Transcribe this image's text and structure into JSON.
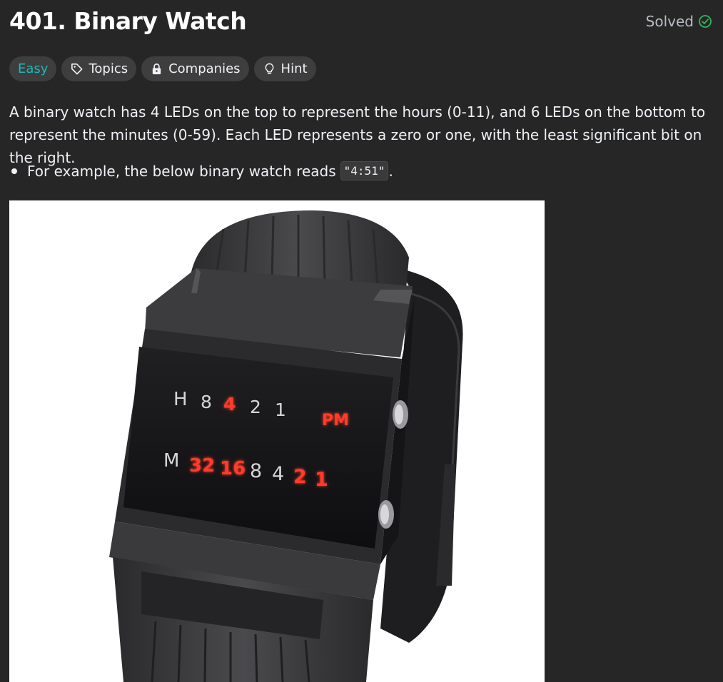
{
  "problem": {
    "title": "401. Binary Watch",
    "status": "Solved",
    "status_color": "#2cbb5d"
  },
  "tags": [
    {
      "label": "Easy",
      "color": "#1cbaba"
    },
    {
      "label": "Topics",
      "icon": "tag-icon"
    },
    {
      "label": "Companies",
      "icon": "lock-icon"
    },
    {
      "label": "Hint",
      "icon": "lightbulb-icon"
    }
  ],
  "description": {
    "paragraph": "A binary watch has 4 LEDs on the top to represent the hours (0-11), and 6 LEDs on the bottom to represent the minutes (0-59). Each LED represents a zero or one, with the least significant bit on the right.",
    "bullet_text": "For example, the below binary watch reads",
    "bullet_code": "\"4:51\"",
    "bullet_end": "."
  },
  "watch": {
    "hour_letter": "H",
    "hour_leds": [
      {
        "label": "8",
        "lit": false
      },
      {
        "label": "4",
        "lit": true
      },
      {
        "label": "2",
        "lit": false
      },
      {
        "label": "1",
        "lit": false
      }
    ],
    "pm_label": "PM",
    "pm_lit": true,
    "minute_letter": "M",
    "minute_leds": [
      {
        "label": "32",
        "lit": true
      },
      {
        "label": "16",
        "lit": true
      },
      {
        "label": "8",
        "lit": false
      },
      {
        "label": "4",
        "lit": false
      },
      {
        "label": "2",
        "lit": true
      },
      {
        "label": "1",
        "lit": true
      }
    ],
    "led_on_color": "#ff3b2a",
    "led_off_color": "#d6d6d6"
  }
}
